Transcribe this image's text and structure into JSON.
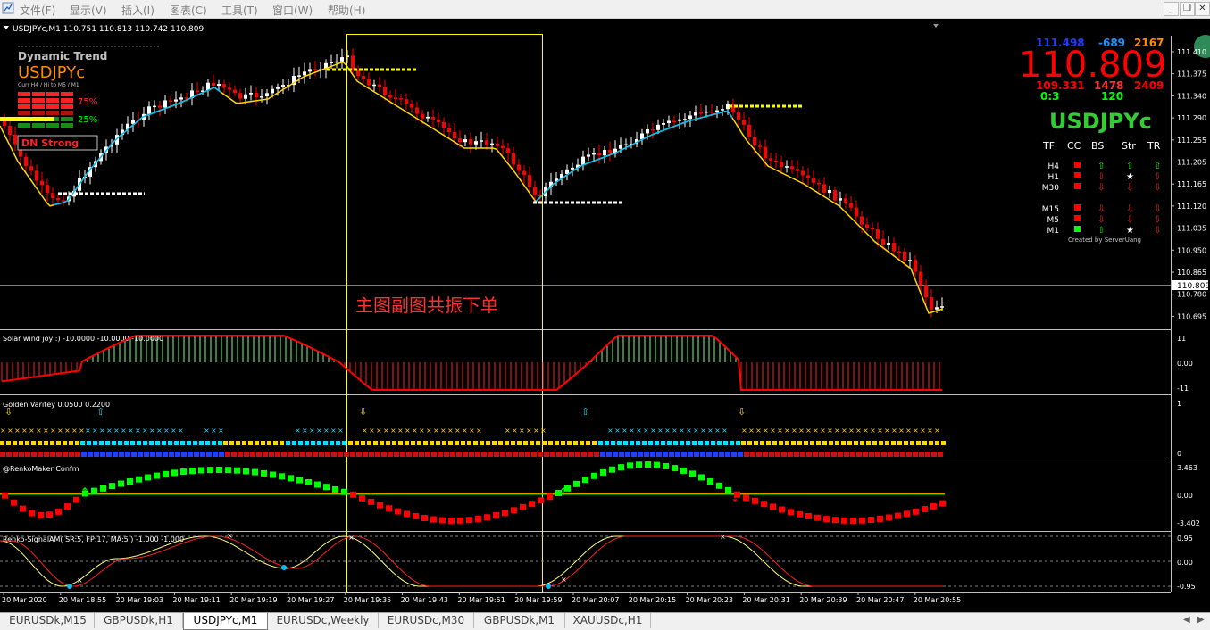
{
  "menu": {
    "items": [
      "文件(F)",
      "显示(V)",
      "插入(I)",
      "图表(C)",
      "工具(T)",
      "窗口(W)",
      "帮助(H)"
    ]
  },
  "main_chart": {
    "header": "USDJPYc,M1  110.751 110.813 110.742 110.809",
    "price_axis": [
      "111.410",
      "111.375",
      "111.340",
      "111.290",
      "111.255",
      "111.205",
      "111.165",
      "111.120",
      "111.035",
      "110.950",
      "110.865",
      "110.780",
      "110.695"
    ],
    "current_price": "110.809",
    "annotation": "主图副图共振下单",
    "dashboard": {
      "title": "Dynamic Trend",
      "symbol": "USDJPYc",
      "subheader": "Curr  H4 / Hi  to  M5 / M1",
      "pct_up": "75%",
      "pct_down": "25%",
      "signal": "DN Strong"
    },
    "price_panel": {
      "row1": [
        "111.498",
        "-689",
        "2167"
      ],
      "big_price": "110.809",
      "row2": [
        "109.331",
        "1478",
        "2409"
      ],
      "row3": [
        "0:3",
        "120"
      ],
      "symbol": "USDJPYc",
      "headers": [
        "TF",
        "CC",
        "BS",
        "Str",
        "TR"
      ],
      "timeframes": [
        "H4",
        "H1",
        "M30",
        "M15",
        "M5",
        "M1"
      ],
      "credit": "Created by ServerUang"
    }
  },
  "sub1": {
    "label": "Solar wind joy :) -10.0000 -10.0000 -10.0000",
    "axis": [
      "11",
      "0.00",
      "-11"
    ]
  },
  "sub2": {
    "label": "Golden Varitey 0.0500 0.2200",
    "axis": [
      "1",
      "0"
    ]
  },
  "sub3": {
    "label": "@RenkoMaker Confm",
    "axis": [
      "3.463",
      "0.00",
      "-3.402"
    ]
  },
  "sub4": {
    "label": "Renko-SignalAM( SR:5, FP:17, MA:5 ) -1.000 -1.000",
    "axis": [
      "0.95",
      "0.00",
      "-0.95"
    ]
  },
  "time_axis": [
    "20 Mar 2020",
    "20 Mar 18:55",
    "20 Mar 19:03",
    "20 Mar 19:11",
    "20 Mar 19:19",
    "20 Mar 19:27",
    "20 Mar 19:35",
    "20 Mar 19:43",
    "20 Mar 19:51",
    "20 Mar 19:59",
    "20 Mar 20:07",
    "20 Mar 20:15",
    "20 Mar 20:23",
    "20 Mar 20:31",
    "20 Mar 20:39",
    "20 Mar 20:47",
    "20 Mar 20:55"
  ],
  "tabs": [
    {
      "label": "EURUSDk,M15",
      "active": false
    },
    {
      "label": "GBPUSDk,H1",
      "active": false
    },
    {
      "label": "USDJPYc,M1",
      "active": true
    },
    {
      "label": "EURUSDc,Weekly",
      "active": false
    },
    {
      "label": "EURUSDc,M30",
      "active": false
    },
    {
      "label": "GBPUSDk,M1",
      "active": false
    },
    {
      "label": "XAUUSDc,H1",
      "active": false
    }
  ],
  "colors": {
    "bull": "#ffffff",
    "bear": "#ff0000",
    "ma_up": "#00bfff",
    "ma_down": "#ffd700",
    "grid": "#c0c0c0",
    "highlight": "#ffff00",
    "green": "#00ff00",
    "cyan": "#00ffff"
  }
}
